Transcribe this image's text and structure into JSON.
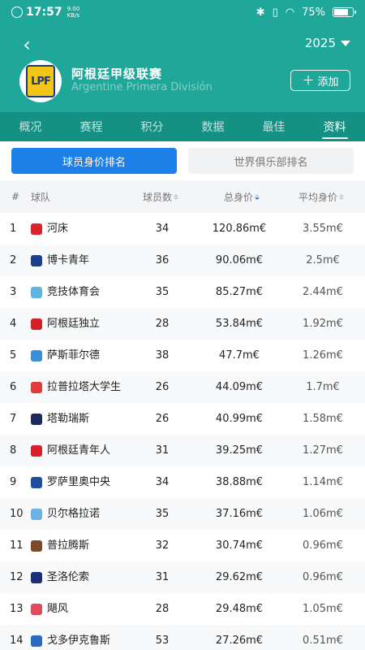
{
  "status_bar": {
    "time": "17:57",
    "net_speed_value": "9.00",
    "net_speed_unit": "KB/s",
    "battery": "75%",
    "battery_fraction": 0.75
  },
  "header": {
    "back_icon": "chevron-left-icon",
    "season": "2025",
    "logo_text": "LPF",
    "league_name": "阿根廷甲级联赛",
    "league_name_en": "Argentine Primera División",
    "add_button": "添加"
  },
  "tabs": [
    {
      "label": "概况",
      "active": false
    },
    {
      "label": "赛程",
      "active": false
    },
    {
      "label": "积分",
      "active": false
    },
    {
      "label": "数据",
      "active": false
    },
    {
      "label": "最佳",
      "active": false
    },
    {
      "label": "资料",
      "active": true
    }
  ],
  "subtabs": [
    {
      "label": "球员身价排名",
      "active": true
    },
    {
      "label": "世界俱乐部排名",
      "active": false
    }
  ],
  "table": {
    "headers": {
      "rank": "#",
      "team": "球队",
      "players": "球员数",
      "total_value": "总身价",
      "avg_value": "平均身价"
    },
    "rows": [
      {
        "rank": "1",
        "team": "河床",
        "players": "34",
        "total": "120.86m€",
        "avg": "3.55m€",
        "color": "#d8232a"
      },
      {
        "rank": "2",
        "team": "博卡青年",
        "players": "36",
        "total": "90.06m€",
        "avg": "2.5m€",
        "color": "#1b3f8b"
      },
      {
        "rank": "3",
        "team": "竞技体育会",
        "players": "35",
        "total": "85.27m€",
        "avg": "2.44m€",
        "color": "#5fb4e0"
      },
      {
        "rank": "4",
        "team": "阿根廷独立",
        "players": "28",
        "total": "53.84m€",
        "avg": "1.92m€",
        "color": "#d31f26"
      },
      {
        "rank": "5",
        "team": "萨斯菲尔德",
        "players": "38",
        "total": "47.7m€",
        "avg": "1.26m€",
        "color": "#3a8fd6"
      },
      {
        "rank": "6",
        "team": "拉普拉塔大学生",
        "players": "26",
        "total": "44.09m€",
        "avg": "1.7m€",
        "color": "#e03a3a"
      },
      {
        "rank": "7",
        "team": "塔勒瑞斯",
        "players": "26",
        "total": "40.99m€",
        "avg": "1.58m€",
        "color": "#1a2a5a"
      },
      {
        "rank": "8",
        "team": "阿根廷青年人",
        "players": "31",
        "total": "39.25m€",
        "avg": "1.27m€",
        "color": "#d81f2a"
      },
      {
        "rank": "9",
        "team": "罗萨里奥中央",
        "players": "34",
        "total": "38.88m€",
        "avg": "1.14m€",
        "color": "#1e4ea0"
      },
      {
        "rank": "10",
        "team": "贝尔格拉诺",
        "players": "35",
        "total": "37.16m€",
        "avg": "1.06m€",
        "color": "#6cb3e3"
      },
      {
        "rank": "11",
        "team": "普拉腾斯",
        "players": "32",
        "total": "30.74m€",
        "avg": "0.96m€",
        "color": "#7a4a2a"
      },
      {
        "rank": "12",
        "team": "圣洛伦索",
        "players": "31",
        "total": "29.62m€",
        "avg": "0.96m€",
        "color": "#1a2f7a"
      },
      {
        "rank": "13",
        "team": "飓风",
        "players": "28",
        "total": "29.48m€",
        "avg": "1.05m€",
        "color": "#e04a5a"
      },
      {
        "rank": "14",
        "team": "戈多伊克鲁斯",
        "players": "53",
        "total": "27.26m€",
        "avg": "0.51m€",
        "color": "#2a6ac0"
      }
    ]
  }
}
